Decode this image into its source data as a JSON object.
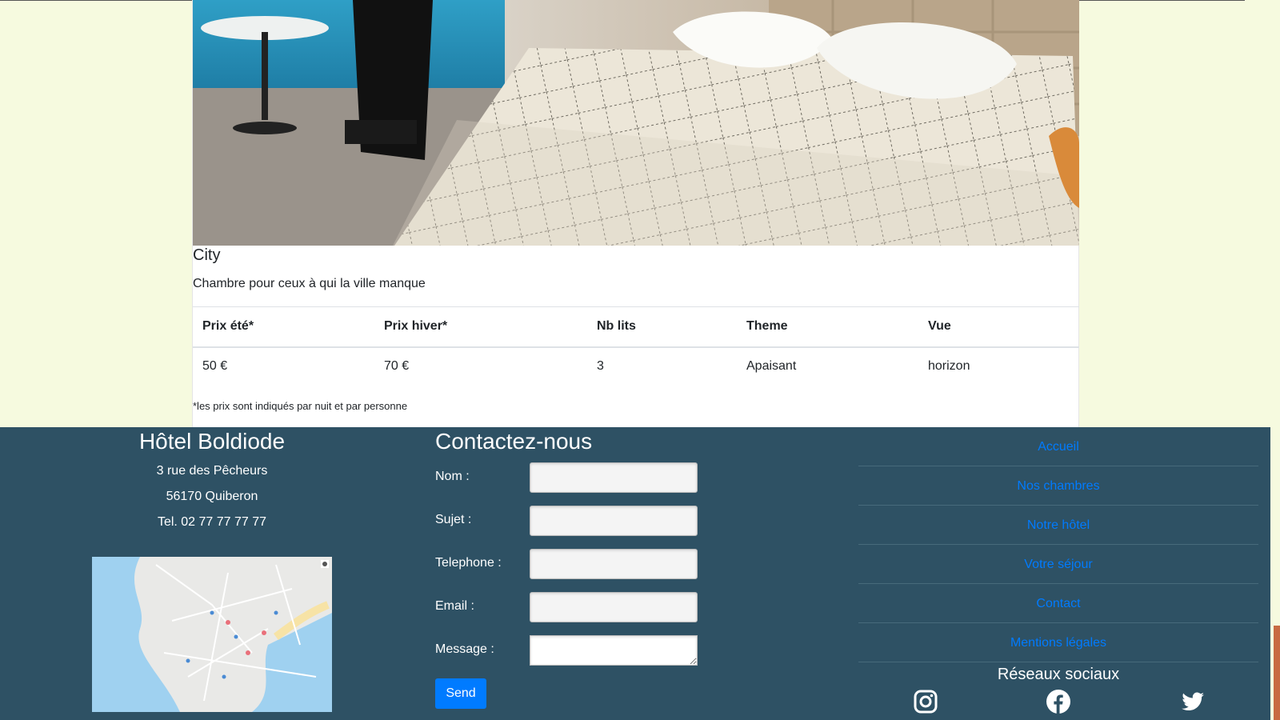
{
  "room": {
    "photo_alt": "Chambre",
    "title": "City",
    "description": "Chambre pour ceux à qui la ville manque",
    "table": {
      "headers": [
        "Prix été*",
        "Prix hiver*",
        "Nb lits",
        "Theme",
        "Vue"
      ],
      "row": [
        "50 €",
        "70 €",
        "3",
        "Apaisant",
        "horizon"
      ]
    },
    "note": "*les prix sont indiqués par nuit et par personne"
  },
  "hotel": {
    "name": "Hôtel Boldiode",
    "address": "3 rue des Pêcheurs",
    "city": "56170 Quiberon",
    "phone": "Tel. 02 77 77 77 77"
  },
  "contact": {
    "title": "Contactez-nous",
    "fields": [
      {
        "label": "Nom :"
      },
      {
        "label": "Sujet :"
      },
      {
        "label": "Telephone :"
      },
      {
        "label": "Email :"
      },
      {
        "label": "Message :"
      }
    ],
    "send_label": "Send"
  },
  "nav": {
    "items": [
      "Accueil",
      "Nos chambres",
      "Notre hôtel",
      "Votre séjour",
      "Contact",
      "Mentions légales"
    ],
    "link_color": "#007bff"
  },
  "social": {
    "title": "Réseaux sociaux",
    "icons": [
      "instagram-icon",
      "facebook-icon",
      "twitter-icon"
    ]
  },
  "colors": {
    "page_bg": "#f6fadf",
    "footer_bg": "#2e5164",
    "accent": "#007bff"
  }
}
